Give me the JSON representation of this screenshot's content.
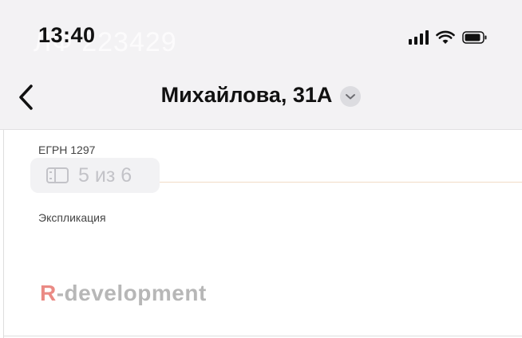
{
  "status_bar": {
    "time": "13:40",
    "watermark": "ЛФ 223429",
    "icons": [
      "signal-icon",
      "wifi-icon",
      "battery-icon"
    ]
  },
  "nav": {
    "back_icon": "chevron-left-icon",
    "title": "Михайлова, 31А",
    "dropdown_icon": "chevron-down-icon"
  },
  "documents": [
    {
      "label": "ЕГРН 1297"
    },
    {
      "label": "Экспликация"
    }
  ],
  "page_counter": {
    "icon": "pages-icon",
    "text": "5 из 6"
  },
  "brand": {
    "r": "R",
    "rest": "-development"
  },
  "colors": {
    "header_bg": "#f3f2f4",
    "accent_line": "#f1dcc6",
    "brand_r": "#ea8a84",
    "brand_text": "#b7b7b7"
  }
}
